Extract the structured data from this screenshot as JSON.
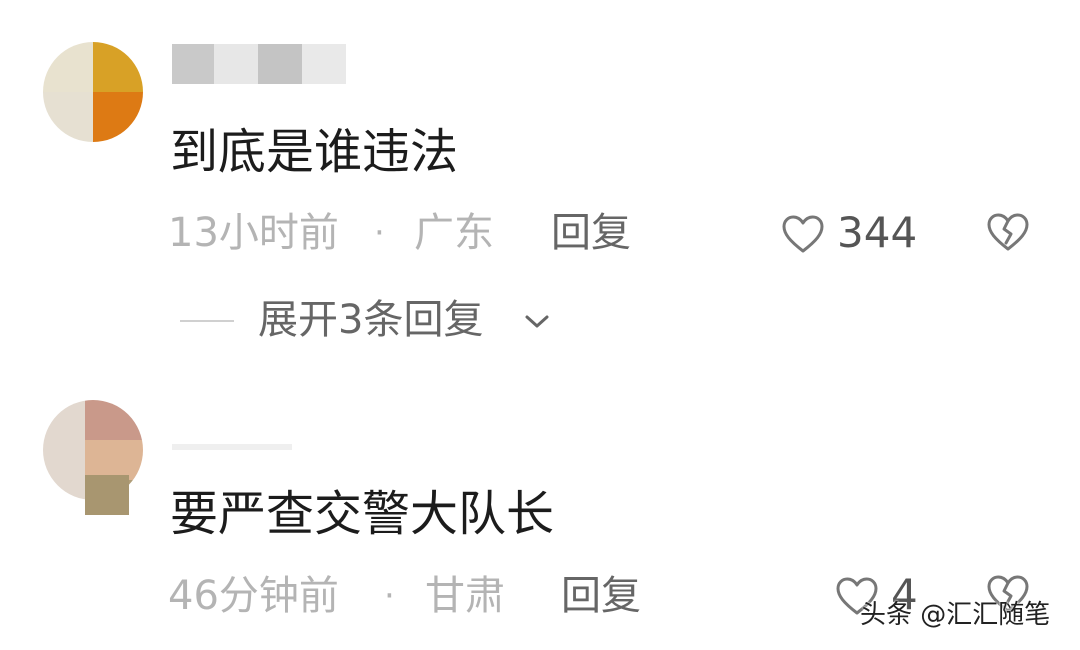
{
  "comments": [
    {
      "text": "到底是谁违法",
      "time": "13小时前",
      "separator": "·",
      "location": "广东",
      "reply_label": "回复",
      "like_count": "344",
      "expand_label": "展开3条回复"
    },
    {
      "text": "要严查交警大队长",
      "time": "46分钟前",
      "separator": "·",
      "location": "甘肃",
      "reply_label": "回复",
      "like_count": "4"
    }
  ],
  "watermark": "头条 @汇汇随笔",
  "colors": {
    "text_primary": "#1c1c1c",
    "text_meta": "#b4b4b4",
    "text_action": "#666666"
  },
  "icons": [
    "heart-outline-icon",
    "broken-heart-icon",
    "chevron-down-icon"
  ]
}
